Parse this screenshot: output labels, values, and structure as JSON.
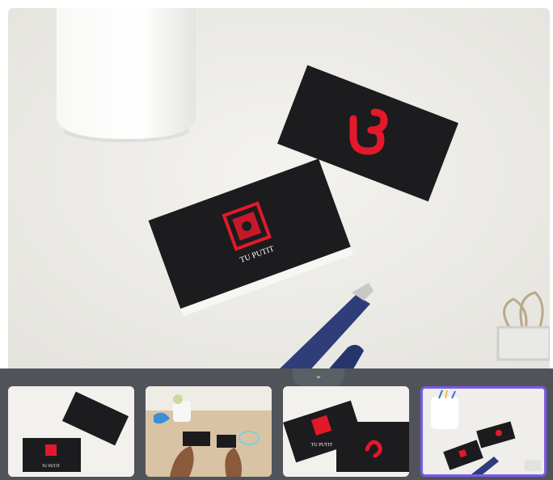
{
  "viewer": {
    "main_image_label": "Business card mockup on desk",
    "card_front_text": "TU PUTIT"
  },
  "thumbnails": [
    {
      "id": "t1",
      "caption": "TU PUTIT",
      "selected": false
    },
    {
      "id": "t2",
      "caption": "",
      "selected": false
    },
    {
      "id": "t3",
      "caption": "TU PUTIT",
      "selected": false
    },
    {
      "id": "t4",
      "caption": "",
      "selected": true
    }
  ],
  "strip": {
    "toggle_icon": "chevron-down-icon",
    "toggle_glyph": "⌄"
  },
  "colors": {
    "card_black": "#1c1c1e",
    "brand_red": "#e3192b",
    "selected_border": "#7b5ce6",
    "strip_bg": "#50545a"
  }
}
